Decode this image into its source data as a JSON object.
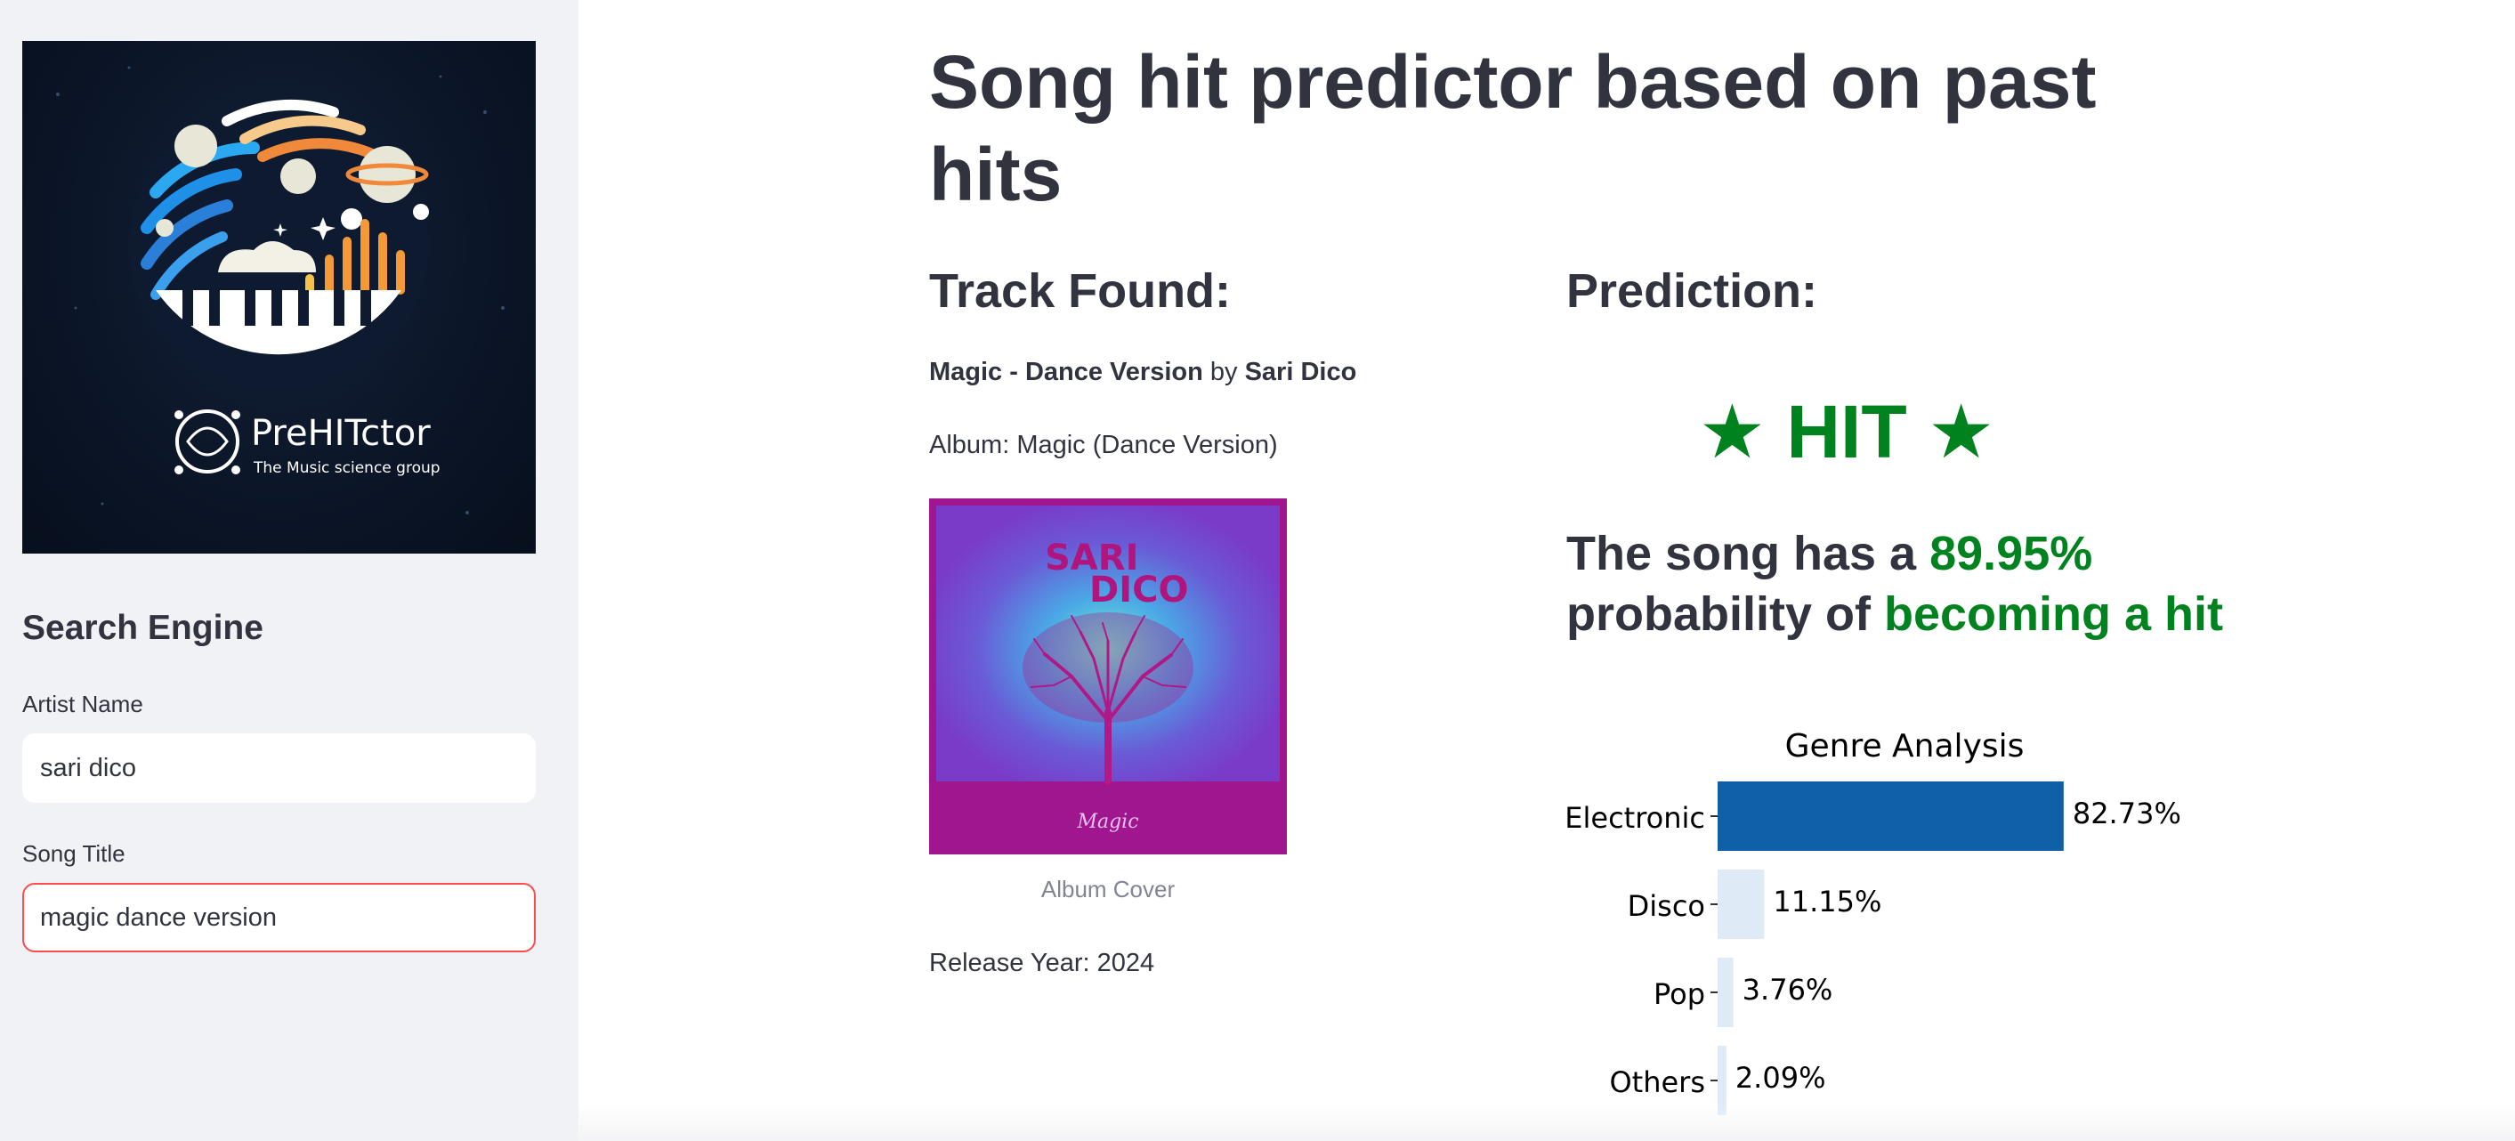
{
  "sidebar": {
    "logo": {
      "name": "PreHITctor",
      "tagline": "The Music science group"
    },
    "search_heading": "Search Engine",
    "artist_label": "Artist Name",
    "artist_value": "sari dico",
    "song_label": "Song Title",
    "song_value": "magic dance version"
  },
  "main": {
    "title": "Song hit predictor based on past hits",
    "track_heading": "Track Found:",
    "track_title": "Magic - Dance Version",
    "track_by": " by ",
    "track_artist": "Sari Dico",
    "album_line": "Album: Magic (Dance Version)",
    "album_cover": {
      "artist_text_line1": "SARI",
      "artist_text_line2": "DICO",
      "album_script": "Magic",
      "caption": "Album Cover"
    },
    "release_line": "Release Year: 2024",
    "prediction_heading": "Prediction:",
    "hit_label": "★ HIT ★",
    "prob_prefix": "The song has a ",
    "prob_value": "89.95%",
    "prob_middle": "probability of ",
    "prob_suffix": "becoming a hit"
  },
  "colors": {
    "accent_green": "#00821f",
    "focus_red": "#ff4b4b",
    "bar_primary": "#1060a8",
    "bar_light": "#deebf7"
  },
  "chart_data": {
    "type": "bar",
    "orientation": "horizontal",
    "title": "Genre Analysis",
    "categories": [
      "Electronic",
      "Disco",
      "Pop",
      "Others"
    ],
    "values": [
      82.73,
      11.15,
      3.76,
      2.09
    ],
    "value_labels": [
      "82.73%",
      "11.15%",
      "3.76%",
      "2.09%"
    ],
    "xlim": [
      0,
      100
    ],
    "grid": false
  }
}
